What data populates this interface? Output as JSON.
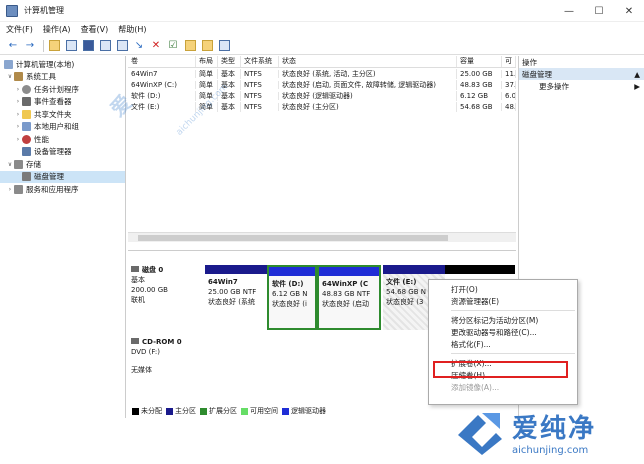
{
  "window": {
    "title": "计算机管理",
    "min": "—",
    "max": "☐",
    "close": "✕"
  },
  "menu": [
    "文件(F)",
    "操作(A)",
    "查看(V)",
    "帮助(H)"
  ],
  "tree": [
    {
      "label": "计算机管理(本地)",
      "indent": 0,
      "caret": ""
    },
    {
      "label": "系统工具",
      "indent": 1,
      "caret": "v"
    },
    {
      "label": "任务计划程序",
      "indent": 2,
      "caret": ">"
    },
    {
      "label": "事件查看器",
      "indent": 2,
      "caret": ">"
    },
    {
      "label": "共享文件夹",
      "indent": 2,
      "caret": ">"
    },
    {
      "label": "本地用户和组",
      "indent": 2,
      "caret": ">"
    },
    {
      "label": "性能",
      "indent": 2,
      "caret": ">"
    },
    {
      "label": "设备管理器",
      "indent": 2,
      "caret": ""
    },
    {
      "label": "存储",
      "indent": 1,
      "caret": "v"
    },
    {
      "label": "磁盘管理",
      "indent": 2,
      "caret": ""
    },
    {
      "label": "服务和应用程序",
      "indent": 1,
      "caret": ">"
    }
  ],
  "volumes": {
    "headers": [
      "卷",
      "布局",
      "类型",
      "文件系统",
      "状态",
      "容量",
      "可"
    ],
    "rows": [
      [
        "64Win7",
        "简单",
        "基本",
        "NTFS",
        "状态良好 (系统, 活动, 主分区)",
        "25.00 GB",
        "11."
      ],
      [
        "64WinXP (C:)",
        "简单",
        "基本",
        "NTFS",
        "状态良好 (启动, 页面文件, 故障转储, 逻辑驱动器)",
        "48.83 GB",
        "37."
      ],
      [
        "软件 (D:)",
        "简单",
        "基本",
        "NTFS",
        "状态良好 (逻辑驱动器)",
        "6.12 GB",
        "6.0"
      ],
      [
        "文件 (E:)",
        "简单",
        "基本",
        "NTFS",
        "状态良好 (主分区)",
        "54.68 GB",
        "48."
      ]
    ]
  },
  "disk0": {
    "name": "磁盘 0",
    "type": "基本",
    "size": "200.00 GB",
    "status": "联机",
    "partitions": [
      {
        "name": "64Win7",
        "size": "25.00 GB NTF",
        "status": "状态良好 (系统"
      },
      {
        "name": "软件  (D:)",
        "size": "6.12 GB N",
        "status": "状态良好 (i"
      },
      {
        "name": "64WinXP  (C",
        "size": "48.83 GB NTF",
        "status": "状态良好 (启动"
      },
      {
        "name": "文件  (E:)",
        "size": "54.68 GB N",
        "status": "状态良好 (3"
      }
    ]
  },
  "cdrom0": {
    "name": "CD-ROM 0",
    "type": "DVD (F:)",
    "status": "无媒体"
  },
  "legend": [
    {
      "label": "未分配",
      "color": "#000000"
    },
    {
      "label": "主分区",
      "color": "#1a1a8c"
    },
    {
      "label": "扩展分区",
      "color": "#2e8b2e"
    },
    {
      "label": "可用空间",
      "color": "#66dd66"
    },
    {
      "label": "逻辑驱动器",
      "color": "#1f2dd6"
    }
  ],
  "actions": {
    "title": "操作",
    "section": "磁盘管理",
    "more": "更多操作"
  },
  "context_menu": [
    {
      "label": "打开(O)",
      "disabled": false
    },
    {
      "label": "资源管理器(E)",
      "disabled": false
    },
    {
      "sep": true
    },
    {
      "label": "将分区标记为活动分区(M)",
      "disabled": false
    },
    {
      "label": "更改驱动器号和路径(C)...",
      "disabled": false
    },
    {
      "label": "格式化(F)...",
      "disabled": false
    },
    {
      "sep": true
    },
    {
      "label": "扩展卷(X)...",
      "disabled": false
    },
    {
      "label": "压缩卷(H)...",
      "disabled": false
    },
    {
      "label": "添加镜像(A)...",
      "disabled": true
    }
  ],
  "watermark": {
    "cn": "爱纯净",
    "url": "aichunjing.com"
  },
  "colors": {
    "highlight": "#e02020",
    "selection": "#cce4f7",
    "accent": "#3a78c4"
  }
}
